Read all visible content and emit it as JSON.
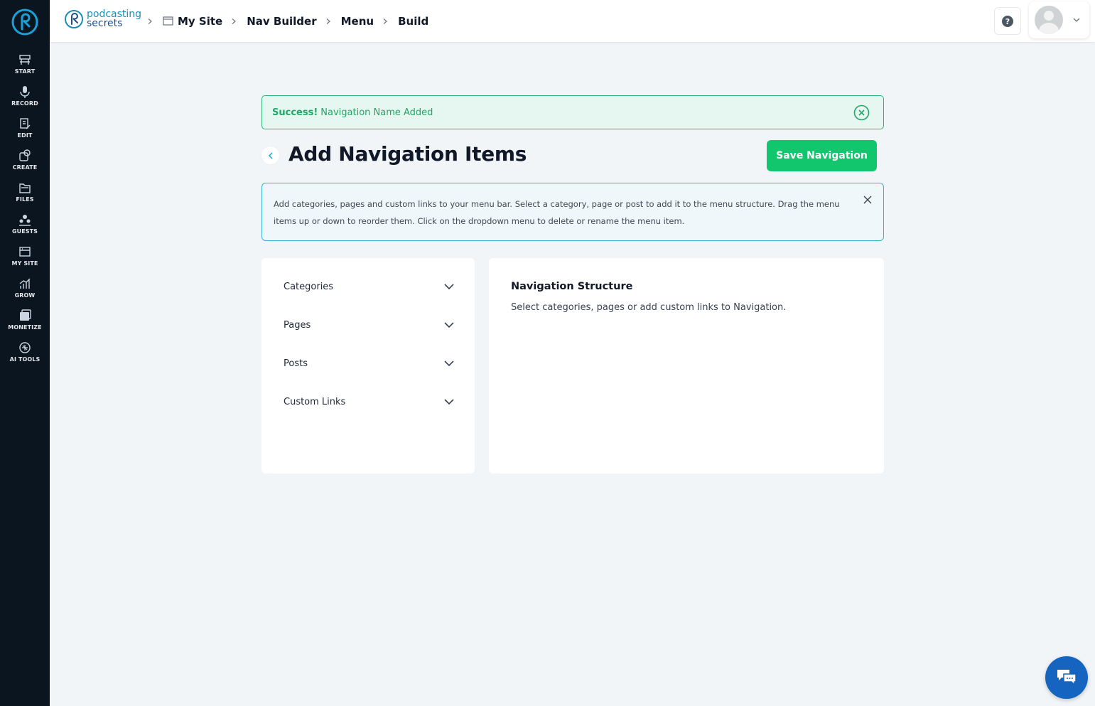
{
  "sidebar": {
    "logo_icon": "podcasting-secrets-logo",
    "items": [
      {
        "label": "START",
        "icon": "start-icon"
      },
      {
        "label": "RECORD",
        "icon": "microphone-icon"
      },
      {
        "label": "EDIT",
        "icon": "edit-icon"
      },
      {
        "label": "CREATE",
        "icon": "create-icon"
      },
      {
        "label": "FILES",
        "icon": "files-icon"
      },
      {
        "label": "GUESTS",
        "icon": "guests-icon"
      },
      {
        "label": "MY SITE",
        "icon": "my-site-icon"
      },
      {
        "label": "GROW",
        "icon": "grow-icon"
      },
      {
        "label": "MONETIZE",
        "icon": "monetize-icon"
      },
      {
        "label": "AI TOOLS",
        "icon": "ai-tools-icon"
      }
    ]
  },
  "header": {
    "brand": {
      "line1": "podcasting",
      "line2": "secrets"
    },
    "breadcrumbs": [
      "My Site",
      "Nav Builder",
      "Menu",
      "Build"
    ],
    "help_icon": "help-icon",
    "profile_icon": "avatar"
  },
  "alert": {
    "strong": "Success!",
    "message": "Navigation Name Added"
  },
  "page": {
    "title": "Add Navigation Items",
    "save_button": "Save Navigation"
  },
  "info": {
    "text": "Add categories, pages and custom links to your menu bar. Select a category, page or post to add it to the menu structure. Drag the menu items up or down to reorder them. Click on the dropdown menu to delete or rename the menu item."
  },
  "accordion": {
    "items": [
      "Categories",
      "Pages",
      "Posts",
      "Custom Links"
    ]
  },
  "structure": {
    "title": "Navigation Structure",
    "subtitle": "Select categories, pages or add custom links to Navigation."
  },
  "colors": {
    "sidebar_bg": "#0b1520",
    "success_green": "#22a565",
    "save_button": "#12c66d",
    "info_border": "#34b4d0",
    "chat_blue": "#1565c0"
  }
}
